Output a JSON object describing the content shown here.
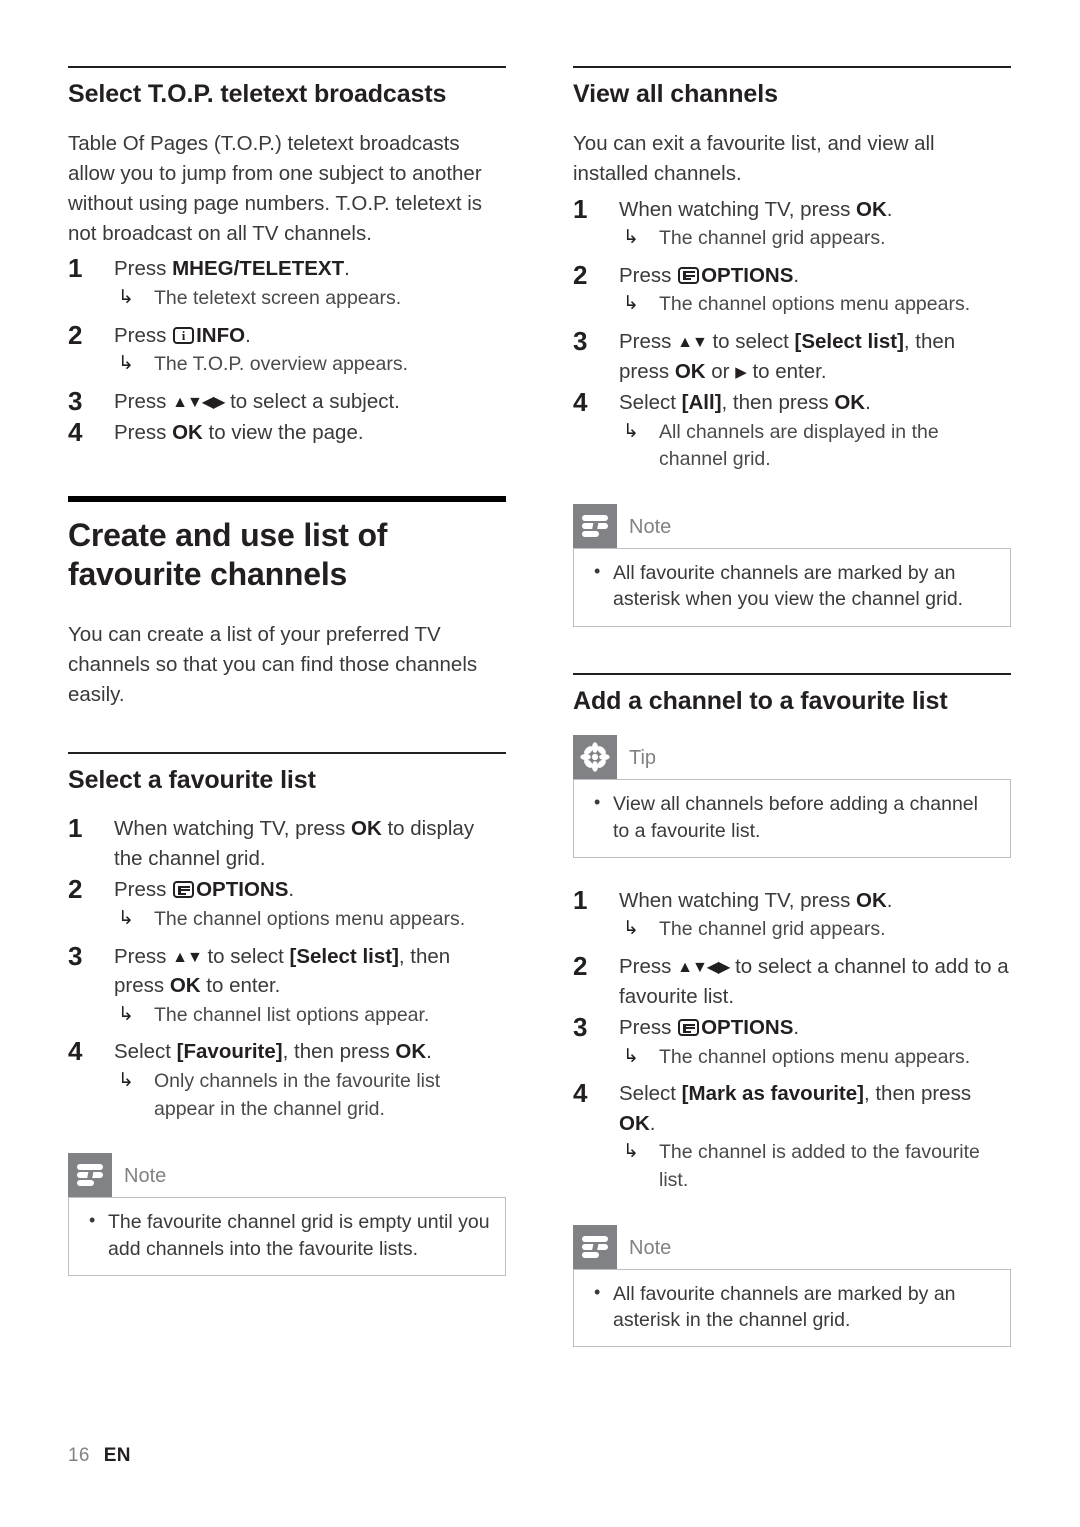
{
  "document": {
    "footer": {
      "page_number": "16",
      "language": "EN"
    }
  },
  "left_column": {
    "section_top": {
      "heading": "Select T.O.P. teletext broadcasts",
      "intro": "Table Of Pages (T.O.P.) teletext broadcasts allow you to jump from one subject to another without using page numbers. T.O.P. teletext is not broadcast on all TV channels.",
      "steps": [
        {
          "number": "1",
          "text_before": "Press ",
          "bold": "MHEG/TELETEXT",
          "text_after": ".",
          "result": "The teletext screen appears."
        },
        {
          "number": "2",
          "text_before": "Press ",
          "icon": "info-key-icon",
          "bold": "INFO",
          "text_after": ".",
          "result": "The T.O.P. overview appears."
        },
        {
          "number": "3",
          "text_before": "Press ",
          "arrows": "▲▼◀▶",
          "text_after": " to select a subject.",
          "result": ""
        },
        {
          "number": "4",
          "text_before": "Press ",
          "bold": "OK",
          "text_after": " to view the page.",
          "result": ""
        }
      ]
    },
    "chapter": {
      "heading": "Create and use list of favourite channels",
      "intro": "You can create a list of your preferred TV channels so that you can find those channels easily."
    },
    "section_favourite_list": {
      "heading": "Select a favourite list",
      "steps": [
        {
          "number": "1",
          "text_before": "When watching TV, press ",
          "bold": "OK",
          "text_after": " to display the channel grid.",
          "result": ""
        },
        {
          "number": "2",
          "text_before": "Press ",
          "icon": "options-key-icon",
          "bold": "OPTIONS",
          "text_after": ".",
          "result": "The channel options menu appears."
        },
        {
          "number": "3",
          "text_before": "Press ",
          "arrows": "▲▼",
          "text_mid": " to select ",
          "bold": "[Select list]",
          "text_after2": ", then press ",
          "bold2": "OK",
          "text_after3": " to enter.",
          "result": "The channel list options appear."
        },
        {
          "number": "4",
          "text_before": "Select ",
          "bold": "[Favourite]",
          "text_after": ", then press ",
          "bold2": "OK",
          "text_after3": ".",
          "result": "Only channels in the favourite list appear in the channel grid."
        }
      ]
    },
    "note": {
      "badge": "note-icon",
      "title": "Note",
      "items": [
        "The favourite channel grid is empty until you add channels into the favourite lists."
      ]
    }
  },
  "right_column": {
    "section_view_all": {
      "heading": "View all channels",
      "intro": "You can exit a favourite list, and view all installed channels.",
      "steps": [
        {
          "number": "1",
          "text_before": "When watching TV, press ",
          "bold": "OK",
          "text_after": ".",
          "result": "The channel grid appears."
        },
        {
          "number": "2",
          "text_before": "Press ",
          "icon": "options-key-icon",
          "bold": "OPTIONS",
          "text_after": ".",
          "result": "The channel options menu appears."
        },
        {
          "number": "3",
          "text_before": "Press ",
          "arrows": "▲▼",
          "text_mid": " to select ",
          "bold": "[Select list]",
          "text_after2": ", then press ",
          "bold2": "OK",
          "text_after3": " or ",
          "arrow_single": "▶",
          "text_after4": " to enter.",
          "result": ""
        },
        {
          "number": "4",
          "text_before": "Select ",
          "bold": "[All]",
          "text_after": ", then press ",
          "bold2": "OK",
          "text_after3": ".",
          "result": "All channels are displayed in the channel grid."
        }
      ]
    },
    "note_top": {
      "badge": "note-icon",
      "title": "Note",
      "items": [
        "All favourite channels are marked by an asterisk when you view the channel grid."
      ]
    },
    "section_add_channel": {
      "heading": "Add a channel to a favourite list",
      "tip": {
        "badge": "tip-icon",
        "title": "Tip",
        "items": [
          "View all channels before adding a channel to a favourite list."
        ]
      },
      "steps": [
        {
          "number": "1",
          "text_before": "When watching TV, press ",
          "bold": "OK",
          "text_after": ".",
          "result": "The channel grid appears."
        },
        {
          "number": "2",
          "text_before": "Press ",
          "arrows": "▲▼◀▶",
          "text_after": " to select a channel to add to a favourite list.",
          "result": ""
        },
        {
          "number": "3",
          "text_before": "Press ",
          "icon": "options-key-icon",
          "bold": "OPTIONS",
          "text_after": ".",
          "result": "The channel options menu appears."
        },
        {
          "number": "4",
          "text_before": "Select ",
          "bold": "[Mark as favourite]",
          "text_after": ", then press ",
          "bold2": "OK",
          "text_after3": ".",
          "result": "The channel is added to the favourite list."
        }
      ]
    },
    "note_bottom": {
      "badge": "note-icon",
      "title": "Note",
      "items": [
        "All favourite channels are marked by an asterisk in the channel grid."
      ]
    }
  }
}
